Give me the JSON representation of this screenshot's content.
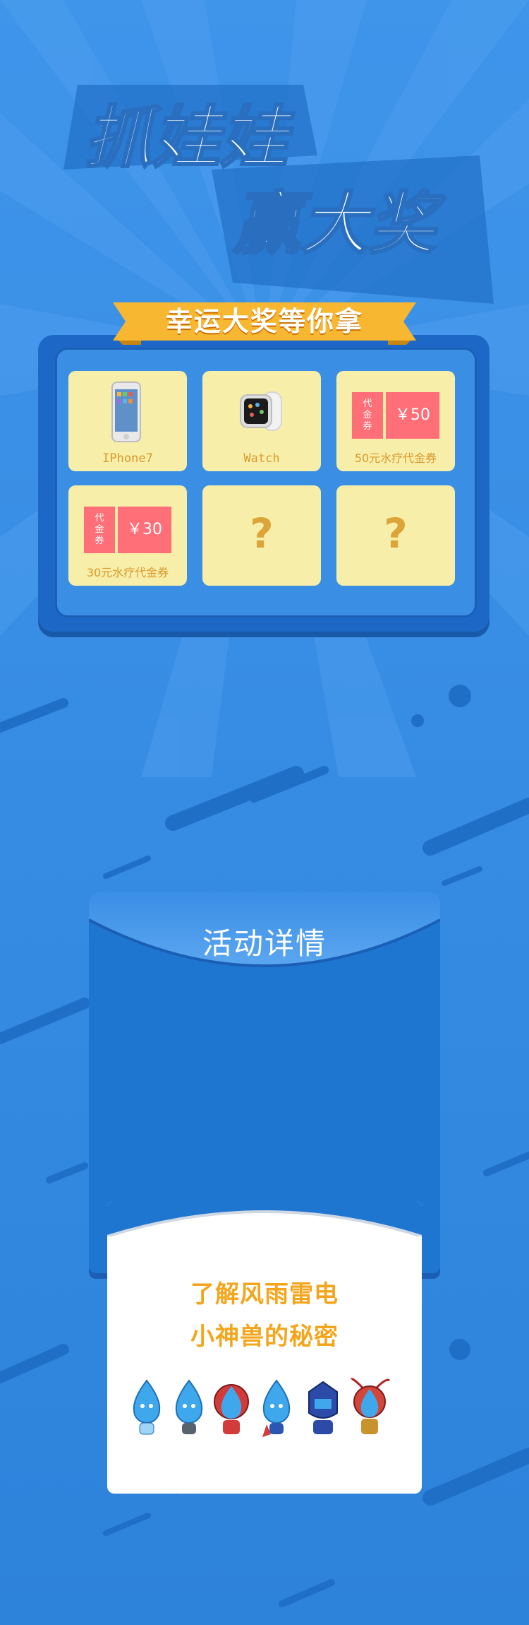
{
  "title": {
    "line1": "抓娃娃",
    "line2": "赢大奖"
  },
  "ribbon": {
    "text": "幸运大奖等你拿"
  },
  "prizes": [
    {
      "label": "IPhone7",
      "type": "phone-icon"
    },
    {
      "label": "Watch",
      "type": "watch-icon"
    },
    {
      "label": "50元水疗代金券",
      "coupon_tag": "代金券",
      "coupon_value": "￥50"
    },
    {
      "label": "30元水疗代金券",
      "coupon_tag": "代金券",
      "coupon_value": "￥30"
    },
    {
      "label": "",
      "mystery": "?"
    },
    {
      "label": "",
      "mystery": "?"
    }
  ],
  "details": {
    "title": "活动详情",
    "line1": "了解风雨雷电",
    "line2": "小神兽的秘密"
  },
  "colors": {
    "background": "#2f86df",
    "board": "#1d68c6",
    "prize_card": "#f7eeaa",
    "ribbon": "#f7b731",
    "coupon": "#ff6f78",
    "accent_text": "#f3a61c"
  }
}
